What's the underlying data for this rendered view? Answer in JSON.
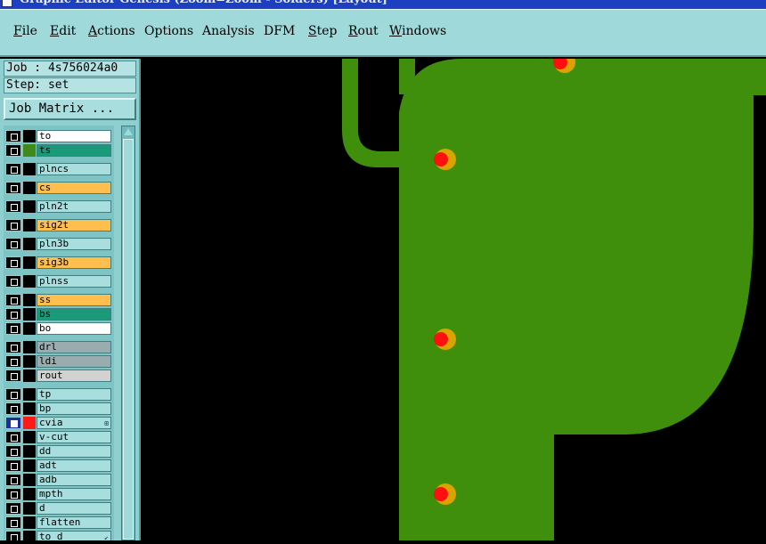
{
  "window": {
    "title": "Graphic Editor Genesis (Zoom=Zoom - Solders) [Layout]"
  },
  "menu": [
    {
      "label": "File",
      "mnemonic": "F"
    },
    {
      "label": "Edit",
      "mnemonic": "E"
    },
    {
      "label": "Actions",
      "mnemonic": "A"
    },
    {
      "label": "Options",
      "mnemonic": ""
    },
    {
      "label": "Analysis",
      "mnemonic": ""
    },
    {
      "label": "DFM",
      "mnemonic": ""
    },
    {
      "label": "Step",
      "mnemonic": "S"
    },
    {
      "label": "Rout",
      "mnemonic": "R"
    },
    {
      "label": "Windows",
      "mnemonic": "W"
    }
  ],
  "info": {
    "job": "Job : 4s756024a0",
    "step": "Step: set",
    "job_matrix_button": "Job Matrix ..."
  },
  "layers": [
    {
      "name": "to",
      "color": "#ffffff",
      "swatch": "#000000",
      "box": "normal"
    },
    {
      "name": "ts",
      "color": "#1a9a78",
      "swatch": "#3f8a1a",
      "box": "normal"
    },
    {
      "name": "plncs",
      "color": "#a9dede",
      "swatch": "#000000",
      "box": "normal"
    },
    {
      "name": "cs",
      "color": "#ffbf4f",
      "swatch": "#000000",
      "box": "normal"
    },
    {
      "name": "pln2t",
      "color": "#a9dede",
      "swatch": "#000000",
      "box": "normal"
    },
    {
      "name": "sig2t",
      "color": "#ffbf4f",
      "swatch": "#000000",
      "box": "normal"
    },
    {
      "name": "pln3b",
      "color": "#a9dede",
      "swatch": "#000000",
      "box": "normal"
    },
    {
      "name": "sig3b",
      "color": "#ffbf4f",
      "swatch": "#000000",
      "box": "normal"
    },
    {
      "name": "plnss",
      "color": "#a9dede",
      "swatch": "#000000",
      "box": "normal"
    },
    {
      "name": "ss",
      "color": "#ffbf4f",
      "swatch": "#000000",
      "box": "normal"
    },
    {
      "name": "bs",
      "color": "#1a9a78",
      "swatch": "#000000",
      "box": "normal"
    },
    {
      "name": "bo",
      "color": "#ffffff",
      "swatch": "#000000",
      "box": "normal"
    },
    {
      "name": "drl",
      "color": "#9aacb0",
      "swatch": "#000000",
      "box": "normal"
    },
    {
      "name": "ldi",
      "color": "#9aacb0",
      "swatch": "#000000",
      "box": "normal"
    },
    {
      "name": "rout",
      "color": "#d2d2d2",
      "swatch": "#000000",
      "box": "normal"
    },
    {
      "name": "tp",
      "color": "#a9dede",
      "swatch": "#000000",
      "box": "normal"
    },
    {
      "name": "bp",
      "color": "#a9dede",
      "swatch": "#000000",
      "box": "normal"
    },
    {
      "name": "cvia",
      "color": "#a9dede",
      "swatch": "#ff1a1a",
      "box": "blue",
      "tag": "⊞"
    },
    {
      "name": "v-cut",
      "color": "#a9dede",
      "swatch": "#000000",
      "box": "normal"
    },
    {
      "name": "dd",
      "color": "#a9dede",
      "swatch": "#000000",
      "box": "normal"
    },
    {
      "name": "adt",
      "color": "#a9dede",
      "swatch": "#000000",
      "box": "normal"
    },
    {
      "name": "adb",
      "color": "#a9dede",
      "swatch": "#000000",
      "box": "normal"
    },
    {
      "name": "mpth",
      "color": "#a9dede",
      "swatch": "#000000",
      "box": "normal"
    },
    {
      "name": "d",
      "color": "#a9dede",
      "swatch": "#000000",
      "box": "normal"
    },
    {
      "name": "flatten",
      "color": "#a9dede",
      "swatch": "#000000",
      "box": "normal"
    },
    {
      "name": "to_d",
      "color": "#a9dede",
      "swatch": "#000000",
      "box": "normal",
      "tag": "↙"
    }
  ],
  "canvas": {
    "copper_color": "#3f8f0c",
    "pad_outer_color": "#d9a400",
    "pad_inner_color": "#ff1010",
    "background": "#000000"
  }
}
